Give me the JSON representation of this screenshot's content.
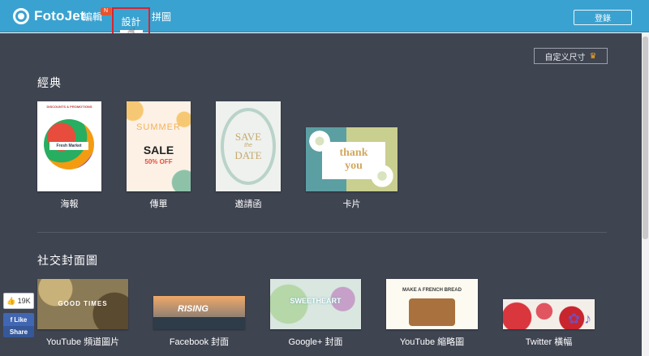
{
  "app": {
    "logo_text": "FotoJet"
  },
  "nav": {
    "edit_label": "編輯",
    "design_label": "設計",
    "collage_label": "拼圖",
    "badge_text": "N"
  },
  "header": {
    "login_label": "登錄"
  },
  "toolbar": {
    "custom_size_label": "自定义尺寸"
  },
  "sections": {
    "classic": {
      "title": "經典",
      "items": [
        {
          "label": "海報",
          "thumb_text": "DISCOUNTS & PROMOTIONS",
          "thumb_sub": "Fresh Market"
        },
        {
          "label": "傳單",
          "thumb_text": "SUMMER",
          "thumb_sub": "SALE",
          "thumb_extra": "50% OFF"
        },
        {
          "label": "邀請函",
          "thumb_text": "SAVE",
          "thumb_mid": "the",
          "thumb_sub": "DATE"
        },
        {
          "label": "卡片",
          "thumb_text": "thank",
          "thumb_sub": "you"
        }
      ]
    },
    "social": {
      "title": "社交封面圖",
      "items": [
        {
          "label": "YouTube 頻道圖片",
          "thumb_text": "GOOD TIMES"
        },
        {
          "label": "Facebook 封面",
          "thumb_text": "RISING"
        },
        {
          "label": "Google+ 封面",
          "thumb_text": "SWEETHEART"
        },
        {
          "label": "YouTube 縮略圖",
          "thumb_text": "MAKE A FRENCH BREAD"
        },
        {
          "label": "Twitter 橫幅",
          "thumb_text": ""
        }
      ]
    }
  },
  "social_widget": {
    "like_count": "19K",
    "like_label": "Like",
    "share_label": "Share"
  },
  "colors": {
    "topbar": "#3aa2d0",
    "main_bg": "#3f4451",
    "highlight": "#d6252f",
    "accent_crown": "#f5a623"
  }
}
